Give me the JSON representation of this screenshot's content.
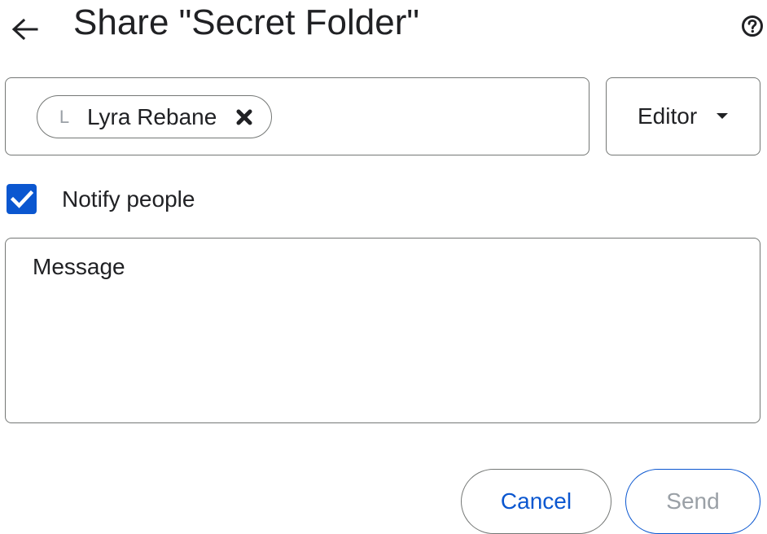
{
  "header": {
    "title": "Share \"Secret Folder\"",
    "back_icon": "arrow-left-icon",
    "help_icon": "help-circle-icon"
  },
  "recipients": {
    "chips": [
      {
        "initial": "L",
        "name": "Lyra Rebane",
        "remove_icon": "close-x-icon"
      }
    ]
  },
  "role": {
    "selected": "Editor",
    "caret_icon": "caret-down-icon"
  },
  "notify": {
    "checked": true,
    "label": "Notify people"
  },
  "message": {
    "placeholder": "Message"
  },
  "actions": {
    "cancel_label": "Cancel",
    "send_label": "Send"
  },
  "colors": {
    "accent": "#0b57d0",
    "border": "#747775",
    "text": "#202124",
    "disabled_text": "#9aa0a6"
  }
}
